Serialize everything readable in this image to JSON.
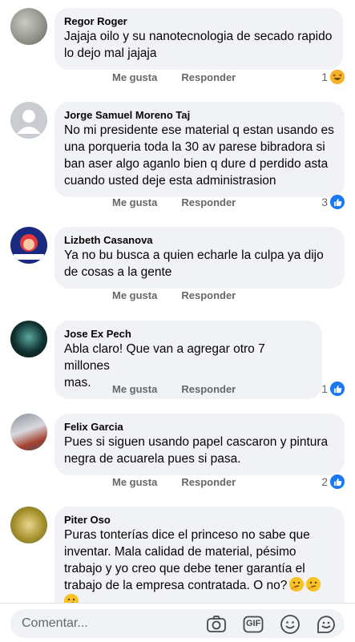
{
  "comments": [
    {
      "author": "Regor Roger",
      "text": "Jajaja oilo y su nanotecnologia de secado rapido\nlo dejo mal jajaja",
      "like": "Me gusta",
      "reply": "Responder",
      "reaction_count": "1",
      "reaction_icon": "haha-icon"
    },
    {
      "author": "Jorge Samuel Moreno Taj",
      "text": "No mi presidente ese material q estan usando es\nuna porqueria toda la 30 av parese bibradora si\nban aser algo aganlo bien q dure d perdido asta\ncuando usted deje esta administrasion",
      "like": "Me gusta",
      "reply": "Responder",
      "reaction_count": "3",
      "reaction_icon": "like-icon"
    },
    {
      "author": "Lizbeth Casanova",
      "text": "Ya no bu busca  a quien  echarle  la culpa ya dijo\nde cosas a la gente",
      "like": "Me gusta",
      "reply": "Responder",
      "reaction_count": "",
      "reaction_icon": ""
    },
    {
      "author": "Jose Ex Pech",
      "text": "Abla claro! Que van a agregar otro 7 millones\nmas.",
      "like": "Me gusta",
      "reply": "Responder",
      "reaction_count": "1",
      "reaction_icon": "like-icon"
    },
    {
      "author": "Felix Garcia",
      "text": "Pues si siguen usando papel cascaron y pintura\nnegra de acuarela pues si pasa.",
      "like": "Me gusta",
      "reply": "Responder",
      "reaction_count": "2",
      "reaction_icon": "like-icon"
    },
    {
      "author": "Piter Oso",
      "text": "Puras tonterías dice el princeso no sabe que\ninventar. Mala calidad de material, pésimo\ntrabajo y yo creo que debe tener garantía el\ntrabajo de la empresa contratada. O no?",
      "like": "",
      "reply": "",
      "reaction_count": "",
      "reaction_icon": ""
    }
  ],
  "composer": {
    "placeholder": "Comentar...",
    "gif_label": "GIF",
    "icons": [
      "camera-icon",
      "gif-icon",
      "smiley-icon",
      "sticker-icon"
    ]
  },
  "colors": {
    "bubble": "#f0f2f5",
    "secondary_text": "#65676b",
    "like_blue": "#1877f2",
    "haha_yellow": "#f7b125"
  }
}
